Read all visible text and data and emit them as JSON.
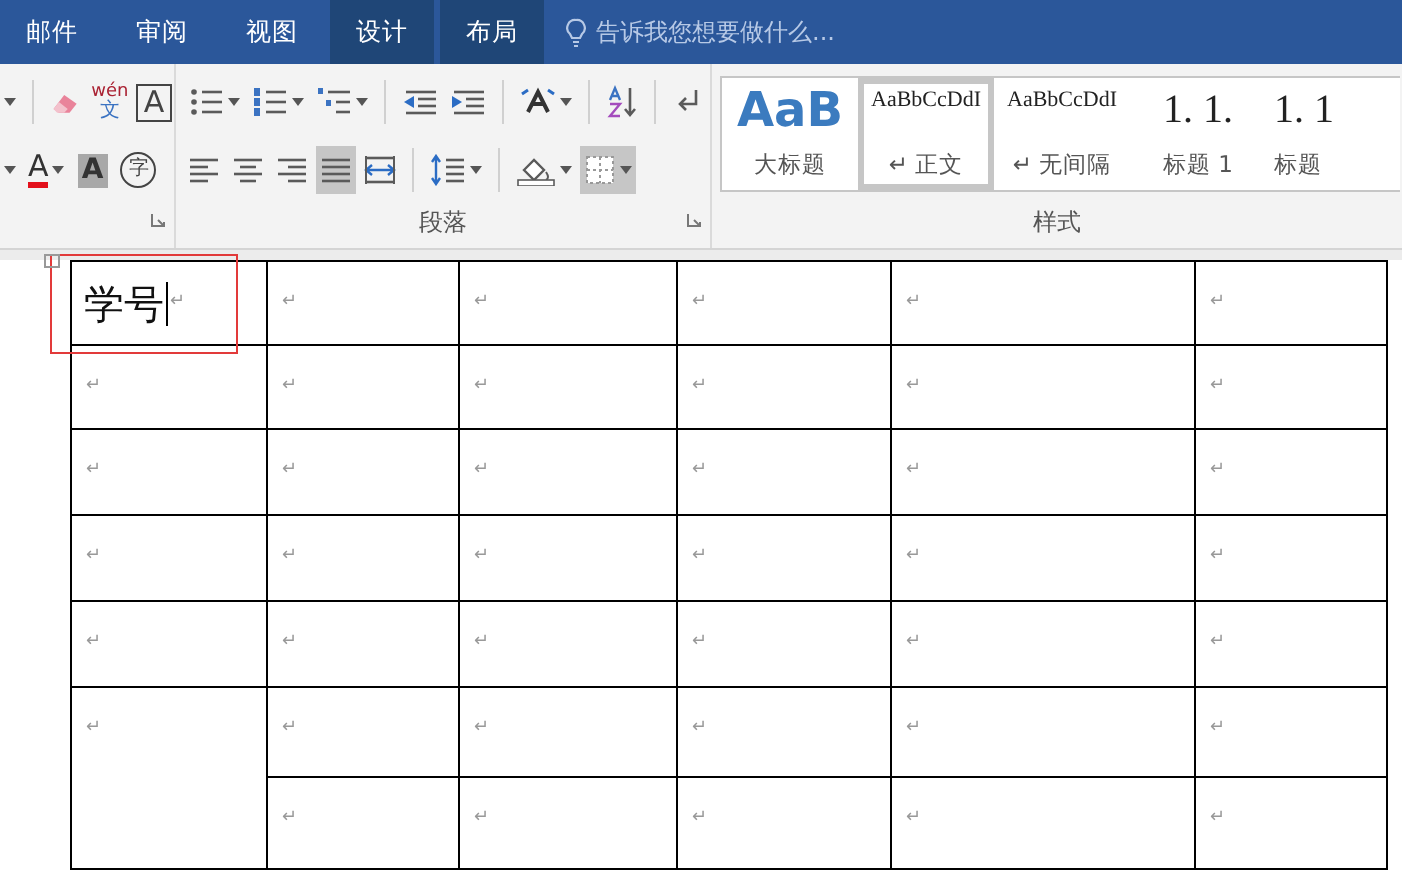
{
  "tabs": [
    {
      "label": "邮件",
      "contextual": false
    },
    {
      "label": "审阅",
      "contextual": false
    },
    {
      "label": "视图",
      "contextual": false
    },
    {
      "label": "设计",
      "contextual": true
    },
    {
      "label": "布局",
      "contextual": true
    }
  ],
  "search": {
    "placeholder": "告诉我您想要做什么..."
  },
  "font_group": {
    "rows": [
      [
        {
          "kind": "caret"
        },
        {
          "kind": "sep"
        },
        {
          "kind": "eraser"
        },
        {
          "kind": "ruby",
          "glyph": "wén",
          "sub": "文"
        },
        {
          "kind": "boxed",
          "glyph": "A"
        }
      ],
      [
        {
          "kind": "caret"
        },
        {
          "kind": "underlined",
          "glyph": "A",
          "dropdown": true
        },
        {
          "kind": "shaded",
          "glyph": "A"
        },
        {
          "kind": "circled",
          "glyph": "字"
        }
      ]
    ]
  },
  "paragraph_group": {
    "label": "段落",
    "rows": [
      [
        {
          "kind": "bullets",
          "dropdown": true,
          "selected": false
        },
        {
          "kind": "numbering",
          "dropdown": true,
          "selected": false
        },
        {
          "kind": "multilevel",
          "dropdown": true,
          "selected": false
        },
        {
          "kind": "sep"
        },
        {
          "kind": "outdent",
          "dropdown": false,
          "selected": false
        },
        {
          "kind": "indent",
          "dropdown": false,
          "selected": false
        },
        {
          "kind": "sep"
        },
        {
          "kind": "direction",
          "dropdown": true,
          "selected": false
        },
        {
          "kind": "sep"
        },
        {
          "kind": "sort",
          "dropdown": false,
          "selected": false
        },
        {
          "kind": "sep"
        },
        {
          "kind": "marks",
          "dropdown": false,
          "selected": false
        }
      ],
      [
        {
          "kind": "left",
          "dropdown": false,
          "selected": false
        },
        {
          "kind": "center",
          "dropdown": false,
          "selected": false
        },
        {
          "kind": "right",
          "dropdown": false,
          "selected": false
        },
        {
          "kind": "justify",
          "dropdown": false,
          "selected": true
        },
        {
          "kind": "distributed",
          "dropdown": false,
          "selected": false
        },
        {
          "kind": "sep"
        },
        {
          "kind": "spacing",
          "dropdown": true,
          "selected": false
        },
        {
          "kind": "sep"
        },
        {
          "kind": "shading",
          "dropdown": true,
          "selected": false
        },
        {
          "kind": "borders",
          "dropdown": true,
          "selected": true
        }
      ]
    ]
  },
  "styles_group": {
    "label": "样式",
    "styles": [
      {
        "preview": "AaB",
        "label": "大标题",
        "kind": "title",
        "selected": false
      },
      {
        "preview": "AaBbCcDdI",
        "label": "↵ 正文",
        "kind": "body",
        "selected": true
      },
      {
        "preview": "AaBbCcDdI",
        "label": "↵ 无间隔",
        "kind": "body",
        "selected": false
      },
      {
        "preview": "1. 1.",
        "label": "标题 1",
        "kind": "heading",
        "selected": false
      },
      {
        "preview": "1. 1",
        "label": "标题",
        "kind": "heading",
        "selected": false
      }
    ]
  },
  "table": {
    "rows": [
      [
        {
          "text": "学号",
          "mark": "↵",
          "caret": true
        },
        {
          "mark": "↵"
        },
        {
          "mark": "↵"
        },
        {
          "mark": "↵"
        },
        {
          "mark": "↵"
        },
        {
          "mark": "↵"
        }
      ],
      [
        {
          "mark": "↵"
        },
        {
          "mark": "↵"
        },
        {
          "mark": "↵"
        },
        {
          "mark": "↵"
        },
        {
          "mark": "↵"
        },
        {
          "mark": "↵"
        }
      ],
      [
        {
          "mark": "↵"
        },
        {
          "mark": "↵"
        },
        {
          "mark": "↵"
        },
        {
          "mark": "↵"
        },
        {
          "mark": "↵"
        },
        {
          "mark": "↵"
        }
      ],
      [
        {
          "mark": "↵"
        },
        {
          "mark": "↵"
        },
        {
          "mark": "↵"
        },
        {
          "mark": "↵"
        },
        {
          "mark": "↵"
        },
        {
          "mark": "↵"
        }
      ],
      [
        {
          "mark": "↵"
        },
        {
          "mark": "↵"
        },
        {
          "mark": "↵"
        },
        {
          "mark": "↵"
        },
        {
          "mark": "↵"
        },
        {
          "mark": "↵"
        }
      ],
      [
        {
          "mark": "↵",
          "rowspan": 2
        },
        {
          "mark": "↵"
        },
        {
          "mark": "↵"
        },
        {
          "mark": "↵"
        },
        {
          "mark": "↵"
        },
        {
          "mark": "↵"
        }
      ],
      [
        {
          "mark": "↵"
        },
        {
          "mark": "↵"
        },
        {
          "mark": "↵"
        },
        {
          "mark": "↵"
        },
        {
          "mark": "↵"
        }
      ]
    ]
  }
}
